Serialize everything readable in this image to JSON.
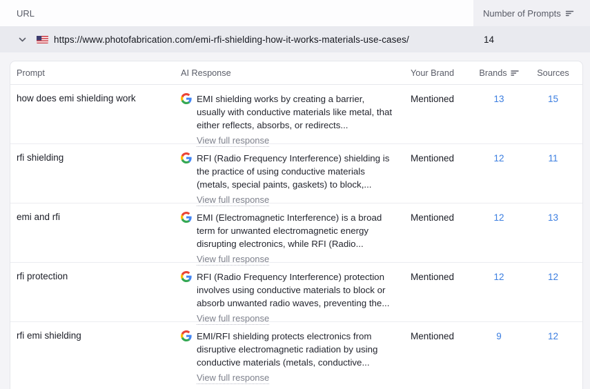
{
  "top_table": {
    "url_header": "URL",
    "prompts_header": "Number of Prompts",
    "url_row": {
      "url": "https://www.photofabrication.com/emi-rfi-shielding-how-it-works-materials-use-cases/",
      "num_prompts": "14",
      "flag": "us-flag",
      "expanded": true
    }
  },
  "prompt_table": {
    "headers": {
      "prompt": "Prompt",
      "response": "AI Response",
      "your_brand": "Your Brand",
      "brands": "Brands",
      "sources": "Sources"
    },
    "view_full_label": "View full response",
    "response_source_icon": "google",
    "rows": [
      {
        "prompt": "how does emi shielding work",
        "response": "EMI shielding works by creating a barrier, usually with conductive materials like metal, that either reflects, absorbs, or redirects...",
        "your_brand": "Mentioned",
        "brands": "13",
        "sources": "15"
      },
      {
        "prompt": "rfi shielding",
        "response": "RFI (Radio Frequency Interference) shielding is the practice of using conductive materials (metals, special paints, gaskets) to block,...",
        "your_brand": "Mentioned",
        "brands": "12",
        "sources": "11"
      },
      {
        "prompt": "emi and rfi",
        "response": "EMI (Electromagnetic Interference) is a broad term for unwanted electromagnetic energy disrupting electronics, while RFI (Radio...",
        "your_brand": "Mentioned",
        "brands": "12",
        "sources": "13"
      },
      {
        "prompt": "rfi protection",
        "response": "RFI (Radio Frequency Interference) protection involves using conductive materials to block or absorb unwanted radio waves, preventing the...",
        "your_brand": "Mentioned",
        "brands": "12",
        "sources": "12"
      },
      {
        "prompt": "rfi emi shielding",
        "response": "EMI/RFI shielding protects electronics from disruptive electromagnetic radiation by using conductive materials (metals, conductive...",
        "your_brand": "Mentioned",
        "brands": "9",
        "sources": "12"
      }
    ]
  },
  "colors": {
    "accent_link": "#3a7de0",
    "row_selected_bg": "#e9eaef",
    "header_cell_bg": "#f0f0f4",
    "page_bg": "#f4f4f7"
  }
}
